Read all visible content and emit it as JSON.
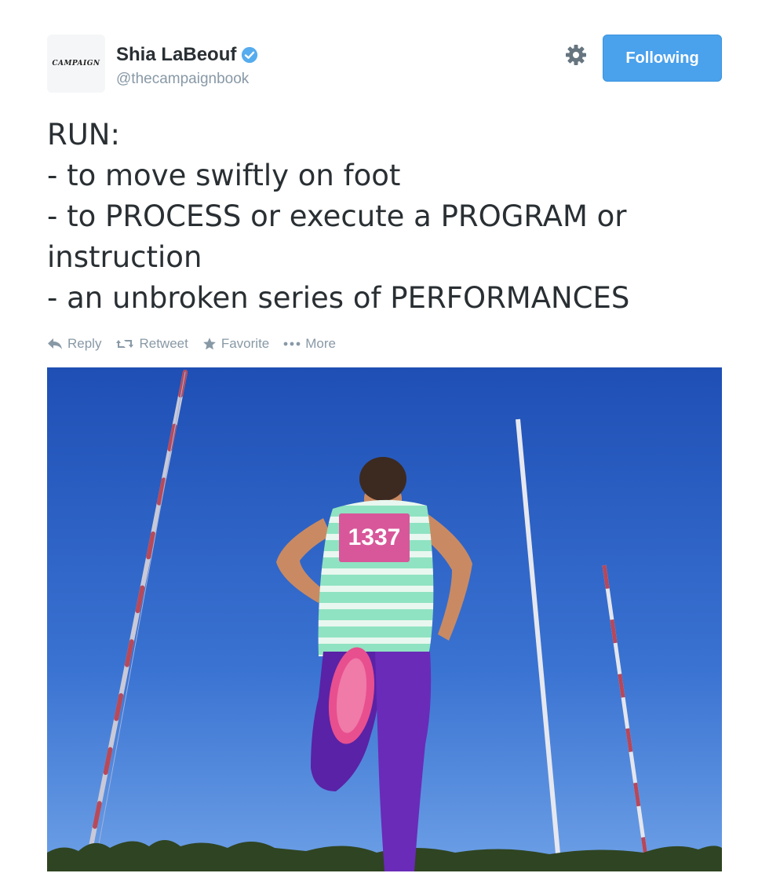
{
  "header": {
    "avatar_text": "CAMPAIGN",
    "display_name": "Shia LaBeouf",
    "handle": "@thecampaignbook",
    "follow_button": "Following"
  },
  "tweet": {
    "lines": [
      "RUN:",
      "- to move swiftly on foot",
      "- to PROCESS or execute a PROGRAM or",
      "instruction",
      "- an unbroken series of PERFORMANCES"
    ]
  },
  "actions": {
    "reply": "Reply",
    "retweet": "Retweet",
    "favorite": "Favorite",
    "more": "More"
  },
  "photo": {
    "bib_number": "1337"
  },
  "colors": {
    "accent": "#4aa1ec",
    "verified": "#55acee",
    "muted": "#8899a6",
    "sky": "#2b5fc0"
  },
  "icons": [
    "verified-badge-icon",
    "gear-icon",
    "reply-icon",
    "retweet-icon",
    "favorite-star-icon",
    "more-dots-icon"
  ]
}
